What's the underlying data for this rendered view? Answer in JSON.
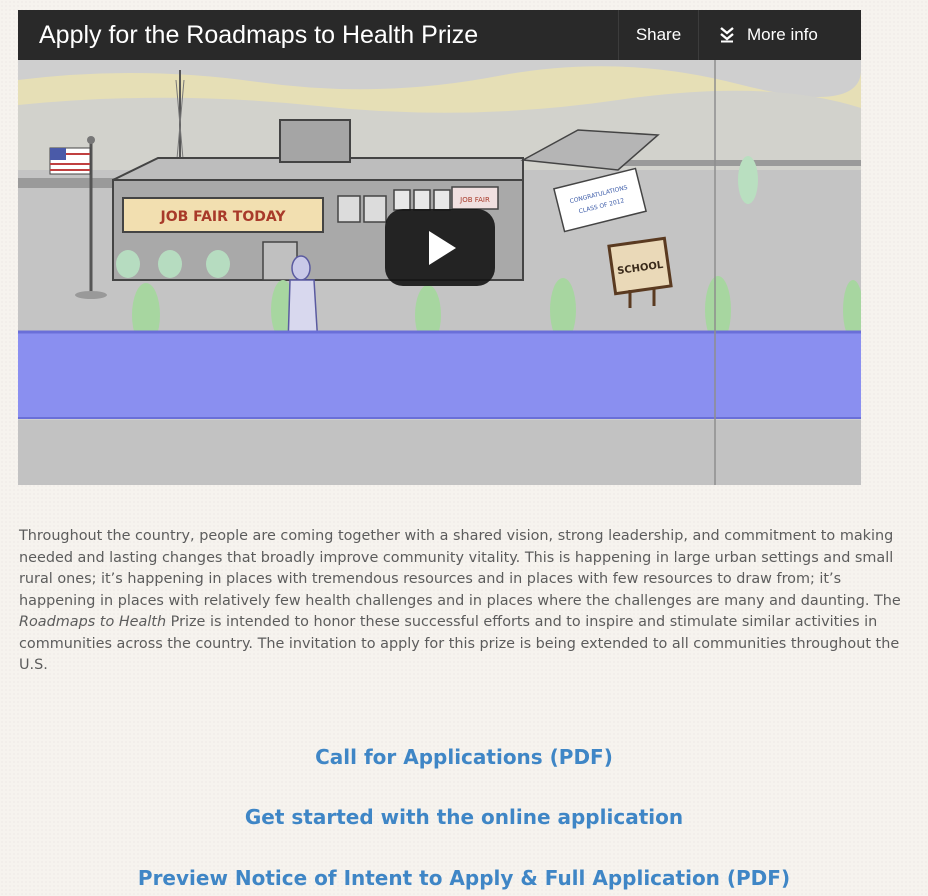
{
  "video": {
    "title": "Apply for the Roadmaps to Health Prize",
    "share_label": "Share",
    "more_info_label": "More info",
    "icons": {
      "more_info": "double-chevron-down-icon",
      "play": "play-icon"
    },
    "scene_signs": {
      "job_fair": "JOB FAIR TODAY",
      "school": "SCHOOL",
      "banner_line1": "CONGRATULATIONS",
      "banner_line2": "CLASS OF 2012",
      "window_sign": "JOB FAIR"
    }
  },
  "description": {
    "part1": "Throughout the country, people are coming together with a shared vision, strong leadership, and commitment to making needed and lasting changes that broadly improve community vitality. This is happening in large urban settings and small rural ones; it’s happening in places with tremendous resources and in places with few resources to draw from; it’s happening in places with relatively few health challenges and in places where the challenges are many and daunting. The ",
    "emphasis": "Roadmaps to Health",
    "part2": " Prize is intended to honor these successful efforts and to inspire and stimulate similar activities in communities across the country. The invitation to apply for this prize is being extended to all communities throughout the U.S."
  },
  "links": {
    "call_for_applications": "Call for Applications (PDF)",
    "online_application": "Get started with the online application",
    "preview_notice": "Preview Notice of Intent to Apply & Full Application (PDF)"
  },
  "colors": {
    "link": "#3f86c6",
    "body_text": "#5c5c5c",
    "video_bar": "#1c1c1c",
    "river": "#8a8ff0"
  }
}
